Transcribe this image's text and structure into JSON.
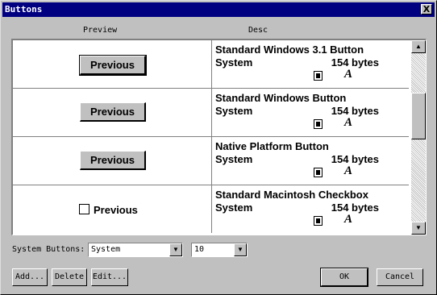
{
  "window": {
    "title": "Buttons",
    "close_glyph": "X"
  },
  "columns": {
    "preview": "Preview",
    "description": "Desc"
  },
  "rows": [
    {
      "preview_label": "Previous",
      "name": "Standard Windows 3.1 Button",
      "font": "System",
      "size": "154 bytes",
      "glyph": "A"
    },
    {
      "preview_label": "Previous",
      "name": "Standard Windows Button",
      "font": "System",
      "size": "154 bytes",
      "glyph": "A"
    },
    {
      "preview_label": "Previous",
      "name": "Native Platform Button",
      "font": "System",
      "size": "154 bytes",
      "glyph": "A"
    },
    {
      "preview_label": "Previous",
      "name": "Standard Macintosh Checkbox",
      "font": "System",
      "size": "154 bytes",
      "glyph": "A"
    }
  ],
  "scrollbar": {
    "up_glyph": "▲",
    "down_glyph": "▼"
  },
  "controls": {
    "system_buttons_label": "System Buttons:",
    "font_value": "System",
    "size_value": "10",
    "dropdown_glyph": "▼"
  },
  "buttons": {
    "add": "Add...",
    "delete": "Delete",
    "edit": "Edit...",
    "ok": "OK",
    "cancel": "Cancel"
  }
}
